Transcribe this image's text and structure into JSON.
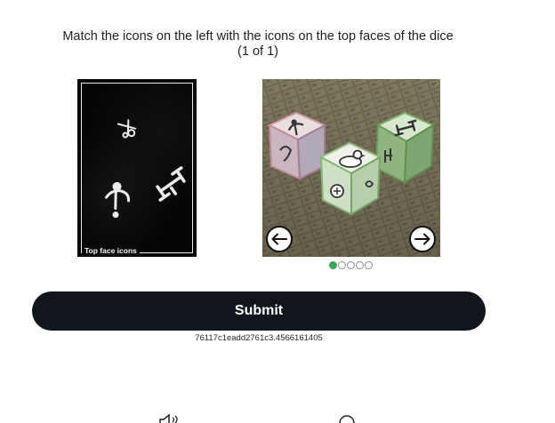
{
  "instructions": {
    "line1": "Match the icons on the left with the icons on the top faces of the dice",
    "line2": "(1 of 1)"
  },
  "icons_panel": {
    "caption": "Top face icons",
    "icons": [
      "scissors-icon",
      "anchor-icon",
      "dumbbell-icon"
    ]
  },
  "dice_panel": {
    "dice_icons": [
      "anchor-icon",
      "duck-icon",
      "dumbbell-icon"
    ],
    "prev_label": "←",
    "next_label": "→"
  },
  "pagination": {
    "total": 5,
    "active_index": 0,
    "active_color": "#3aa657"
  },
  "submit": {
    "label": "Submit"
  },
  "session_id": "76117c1eadd2761c3.4566161405",
  "footer": {
    "icons": [
      "speaker-icon",
      "info-icon"
    ]
  },
  "colors": {
    "submit_bg": "#11161c",
    "panel_bg": "#050505"
  }
}
